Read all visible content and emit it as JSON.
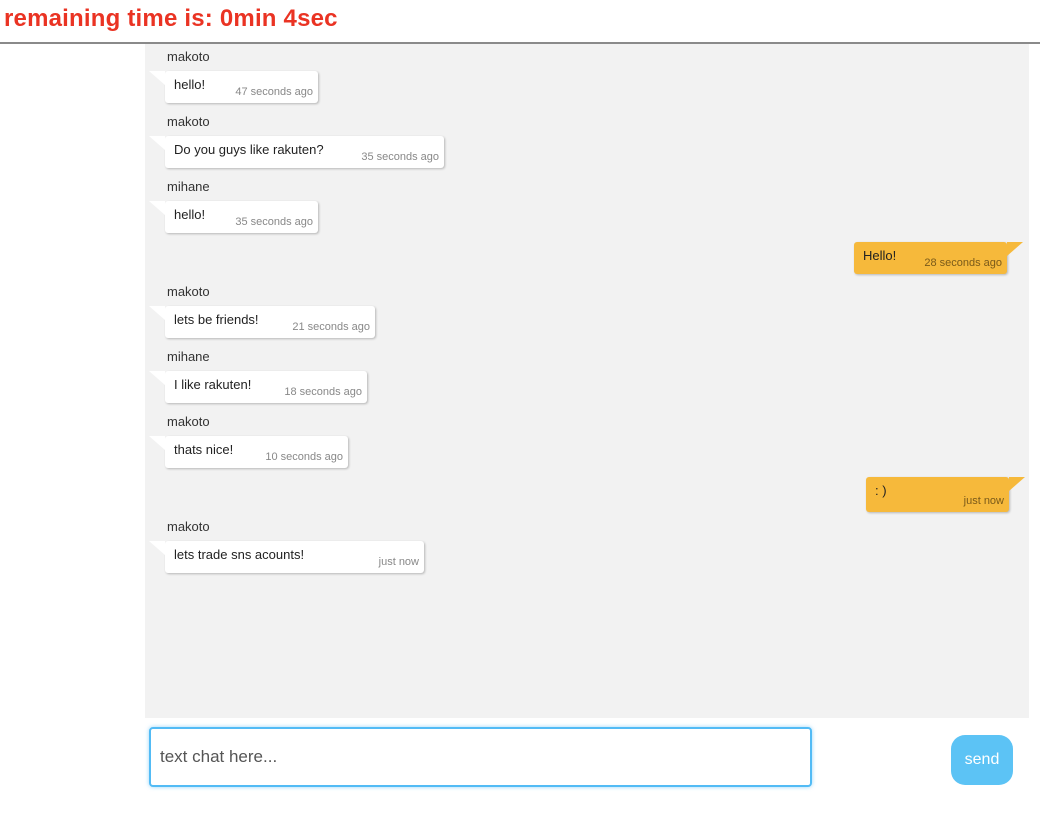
{
  "timer": {
    "text": "remaining time is: 0min 4sec"
  },
  "input": {
    "placeholder": "text chat here..."
  },
  "send_button": {
    "label": "send"
  },
  "colors": {
    "timer": "#ea3323",
    "outgoing_bubble": "#f6b93b",
    "incoming_bubble": "#ffffff",
    "send_button": "#5cc3f5",
    "chat_background": "#f2f2f2"
  },
  "messages": [
    {
      "sender": "makoto",
      "text": "hello!",
      "time": "47 seconds ago",
      "direction": "in"
    },
    {
      "sender": "makoto",
      "text": "Do you guys like rakuten?",
      "time": "35 seconds ago",
      "direction": "in"
    },
    {
      "sender": "mihane",
      "text": "hello!",
      "time": "35 seconds ago",
      "direction": "in"
    },
    {
      "sender": "",
      "text": "Hello!",
      "time": "28 seconds ago",
      "direction": "out"
    },
    {
      "sender": "makoto",
      "text": "lets be friends!",
      "time": "21 seconds ago",
      "direction": "in"
    },
    {
      "sender": "mihane",
      "text": "I like rakuten!",
      "time": "18 seconds ago",
      "direction": "in"
    },
    {
      "sender": "makoto",
      "text": "thats nice!",
      "time": "10 seconds ago",
      "direction": "in"
    },
    {
      "sender": "",
      "text": ": )",
      "time": "just now",
      "direction": "out"
    },
    {
      "sender": "makoto",
      "text": "lets trade sns acounts!",
      "time": "just now",
      "direction": "in"
    }
  ]
}
